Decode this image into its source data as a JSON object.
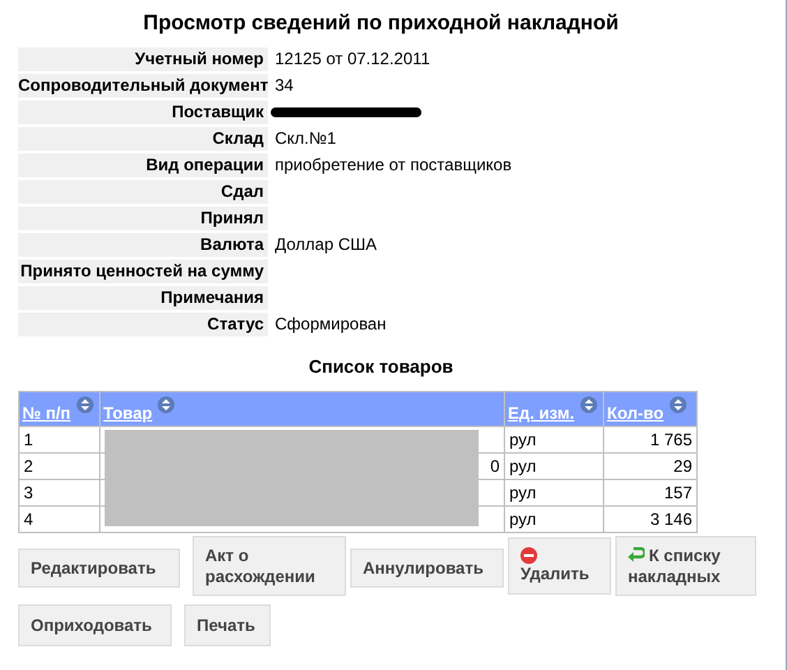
{
  "title": "Просмотр сведений по приходной накладной",
  "fields": [
    {
      "label": "Учетный номер",
      "value": "12125 от 07.12.2011"
    },
    {
      "label": "Сопроводительный документ",
      "value": "34"
    },
    {
      "label": "Поставщик",
      "redacted": true
    },
    {
      "label": "Склад",
      "value": "Скл.№1"
    },
    {
      "label": "Вид операции",
      "value": "приобретение от поставщиков"
    },
    {
      "label": "Сдал"
    },
    {
      "label": "Принял"
    },
    {
      "label": "Валюта",
      "value": "Доллар США"
    },
    {
      "label": "Принято ценностей на сумму"
    },
    {
      "label": "Примечания"
    },
    {
      "label": "Статус",
      "value": "Сформирован"
    }
  ],
  "goods": {
    "title": "Список товаров",
    "columns": [
      "№ п/п",
      "Товар",
      "Ед. изм.",
      "Кол-во"
    ],
    "names_redacted": true,
    "rows": [
      {
        "no": "1",
        "unit": "рул",
        "qty": "1 765"
      },
      {
        "no": "2",
        "name": "0",
        "unit": "рул",
        "qty": "29"
      },
      {
        "no": "3",
        "unit": "рул",
        "qty": "157"
      },
      {
        "no": "4",
        "unit": "рул",
        "qty": "3 146"
      }
    ]
  },
  "buttons": [
    {
      "label": "Редактировать",
      "kind": "plain"
    },
    {
      "label": "Акт о расхождении",
      "kind": "plain"
    },
    {
      "label": "Аннулировать",
      "kind": "plain"
    },
    {
      "label": "Удалить",
      "kind": "delete"
    },
    {
      "label": "К списку накладных",
      "kind": "back"
    },
    {
      "label": "Оприходовать",
      "kind": "plain"
    },
    {
      "label": "Печать",
      "kind": "plain"
    }
  ]
}
